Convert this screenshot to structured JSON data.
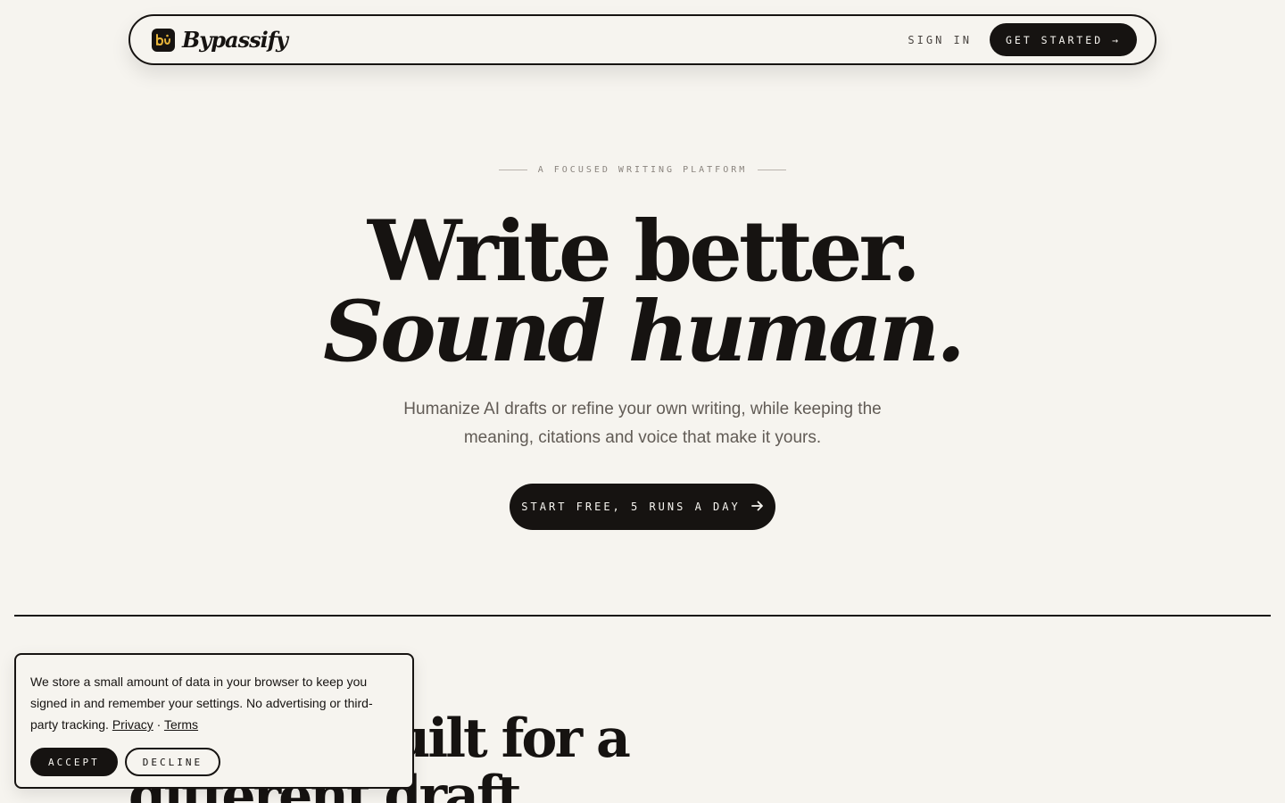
{
  "nav": {
    "brand": "Bypassify",
    "logo_icon": "bi-logo-icon",
    "sign_in": "SIGN IN",
    "get_started": "GET STARTED →"
  },
  "hero": {
    "eyebrow": "A FOCUSED WRITING PLATFORM",
    "title_line1": "Write better.",
    "title_line2": "Sound human.",
    "subtitle": "Humanize AI drafts or refine your own writing, while keeping the meaning, citations and voice that make it yours.",
    "cta_label": "START FREE, 5 RUNS A DAY",
    "cta_icon": "arrow-right-icon"
  },
  "section": {
    "heading": "A touch built for a different draft"
  },
  "cookie": {
    "text": "We store a small amount of data in your browser to keep you signed in and remember your settings. No advertising or third-party tracking.",
    "privacy_link": "Privacy",
    "separator": "·",
    "terms_link": "Terms",
    "accept": "ACCEPT",
    "decline": "DECLINE"
  },
  "colors": {
    "background": "#f6f4ef",
    "ink": "#161311",
    "muted": "#615b55",
    "logo_accent": "#e8b53a"
  }
}
